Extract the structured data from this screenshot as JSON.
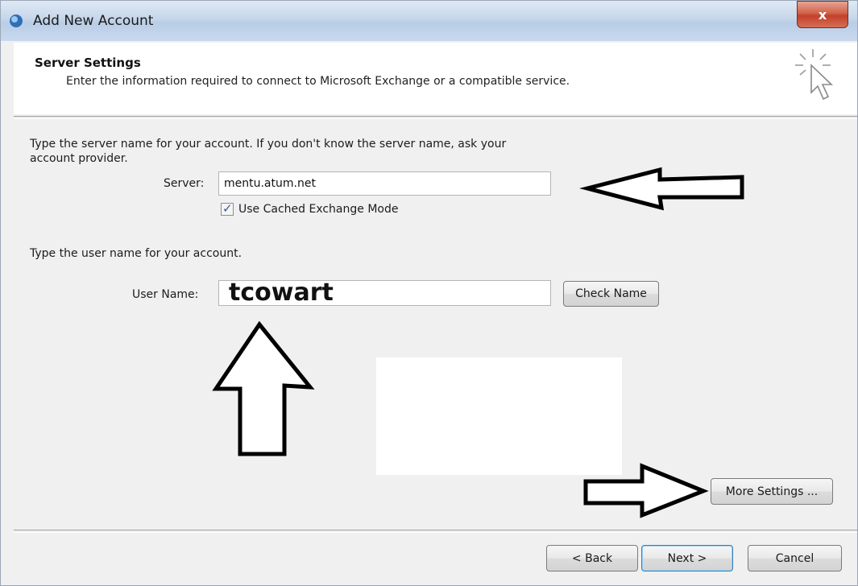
{
  "window": {
    "title": "Add New Account",
    "close_label": "x"
  },
  "header": {
    "title": "Server Settings",
    "subtitle": "Enter the information required to connect to Microsoft Exchange or a compatible service."
  },
  "server_section": {
    "instruction_line1": "Type the server name for your account. If you don't know the server name, ask your",
    "instruction_line2": "account provider.",
    "server_label": "Server:",
    "server_value": "mentu.atum.net",
    "cached_mode_label": "Use Cached Exchange Mode",
    "cached_mode_checked": true
  },
  "user_section": {
    "instruction": "Type the user name for your account.",
    "user_label": "User Name:",
    "user_value": "tcowart",
    "check_name_label": "Check Name"
  },
  "more_settings_label": "More Settings ...",
  "footer": {
    "back_label": "< Back",
    "next_label": "Next >",
    "cancel_label": "Cancel"
  },
  "icons": [
    "window-app-icon",
    "cursor-sparkle-icon",
    "close-icon",
    "checkmark-icon",
    "arrow-left-annotation",
    "arrow-up-annotation",
    "arrow-right-annotation"
  ]
}
